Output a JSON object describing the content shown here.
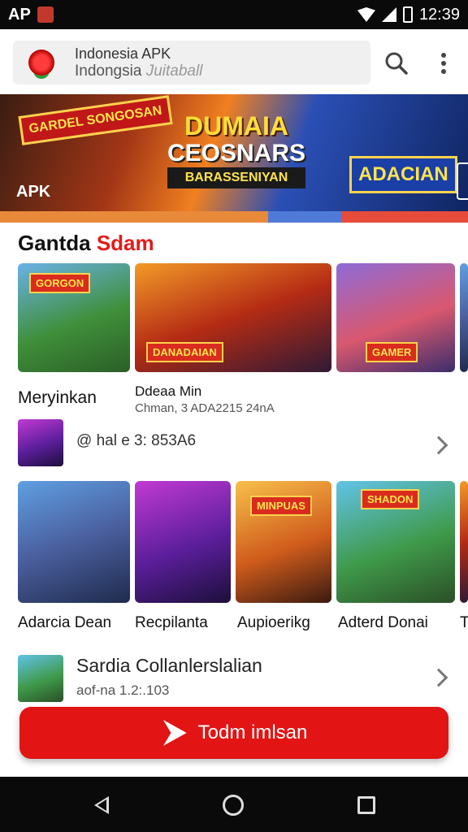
{
  "status_bar": {
    "left_label": "AP",
    "time": "12:39"
  },
  "search": {
    "app_title": "Indonesia APK",
    "app_subtitle_main": "Indongsia",
    "app_subtitle_faded": "Juitaball"
  },
  "banner": {
    "left_badge": "GARDEL SONGOSAN",
    "headline_1": "DUMAIA",
    "headline_2": "CEOSNARS",
    "headline_3": "BARASSENIYAN",
    "right_badge": "ADACIAN",
    "tag": "APK",
    "progress_fraction": 0.73
  },
  "section": {
    "title_main": "Gantda",
    "title_accent": "Sdam"
  },
  "row1": {
    "thumbs": [
      {
        "caption": "GORGON"
      },
      {
        "caption": "DANADAIAN"
      },
      {
        "caption": "GAMER"
      }
    ],
    "labels": [
      {
        "title": "Meryinkan"
      },
      {
        "title": "Ddeaa Min",
        "subtitle": "Chman, 3 ADA2215 24nA"
      }
    ]
  },
  "list_item_1": {
    "text": "@ hal e 3: 853A6"
  },
  "row2": {
    "thumbs": [
      {
        "caption": ""
      },
      {
        "caption": ""
      },
      {
        "caption": "MINPUAS"
      },
      {
        "caption": "SHADON"
      }
    ],
    "labels": [
      "Adarcia Dean",
      "Recpilanta",
      "Aupioerikg",
      "Adterd Donai",
      "T"
    ]
  },
  "list_item_2": {
    "title": "Sardia Collanlerslalian",
    "subtitle": "aof-na 1.2:.103"
  },
  "cta": {
    "label": "Todm imlsan"
  },
  "colors": {
    "accent": "#e21414",
    "status_bar": "#0a0a0a"
  }
}
